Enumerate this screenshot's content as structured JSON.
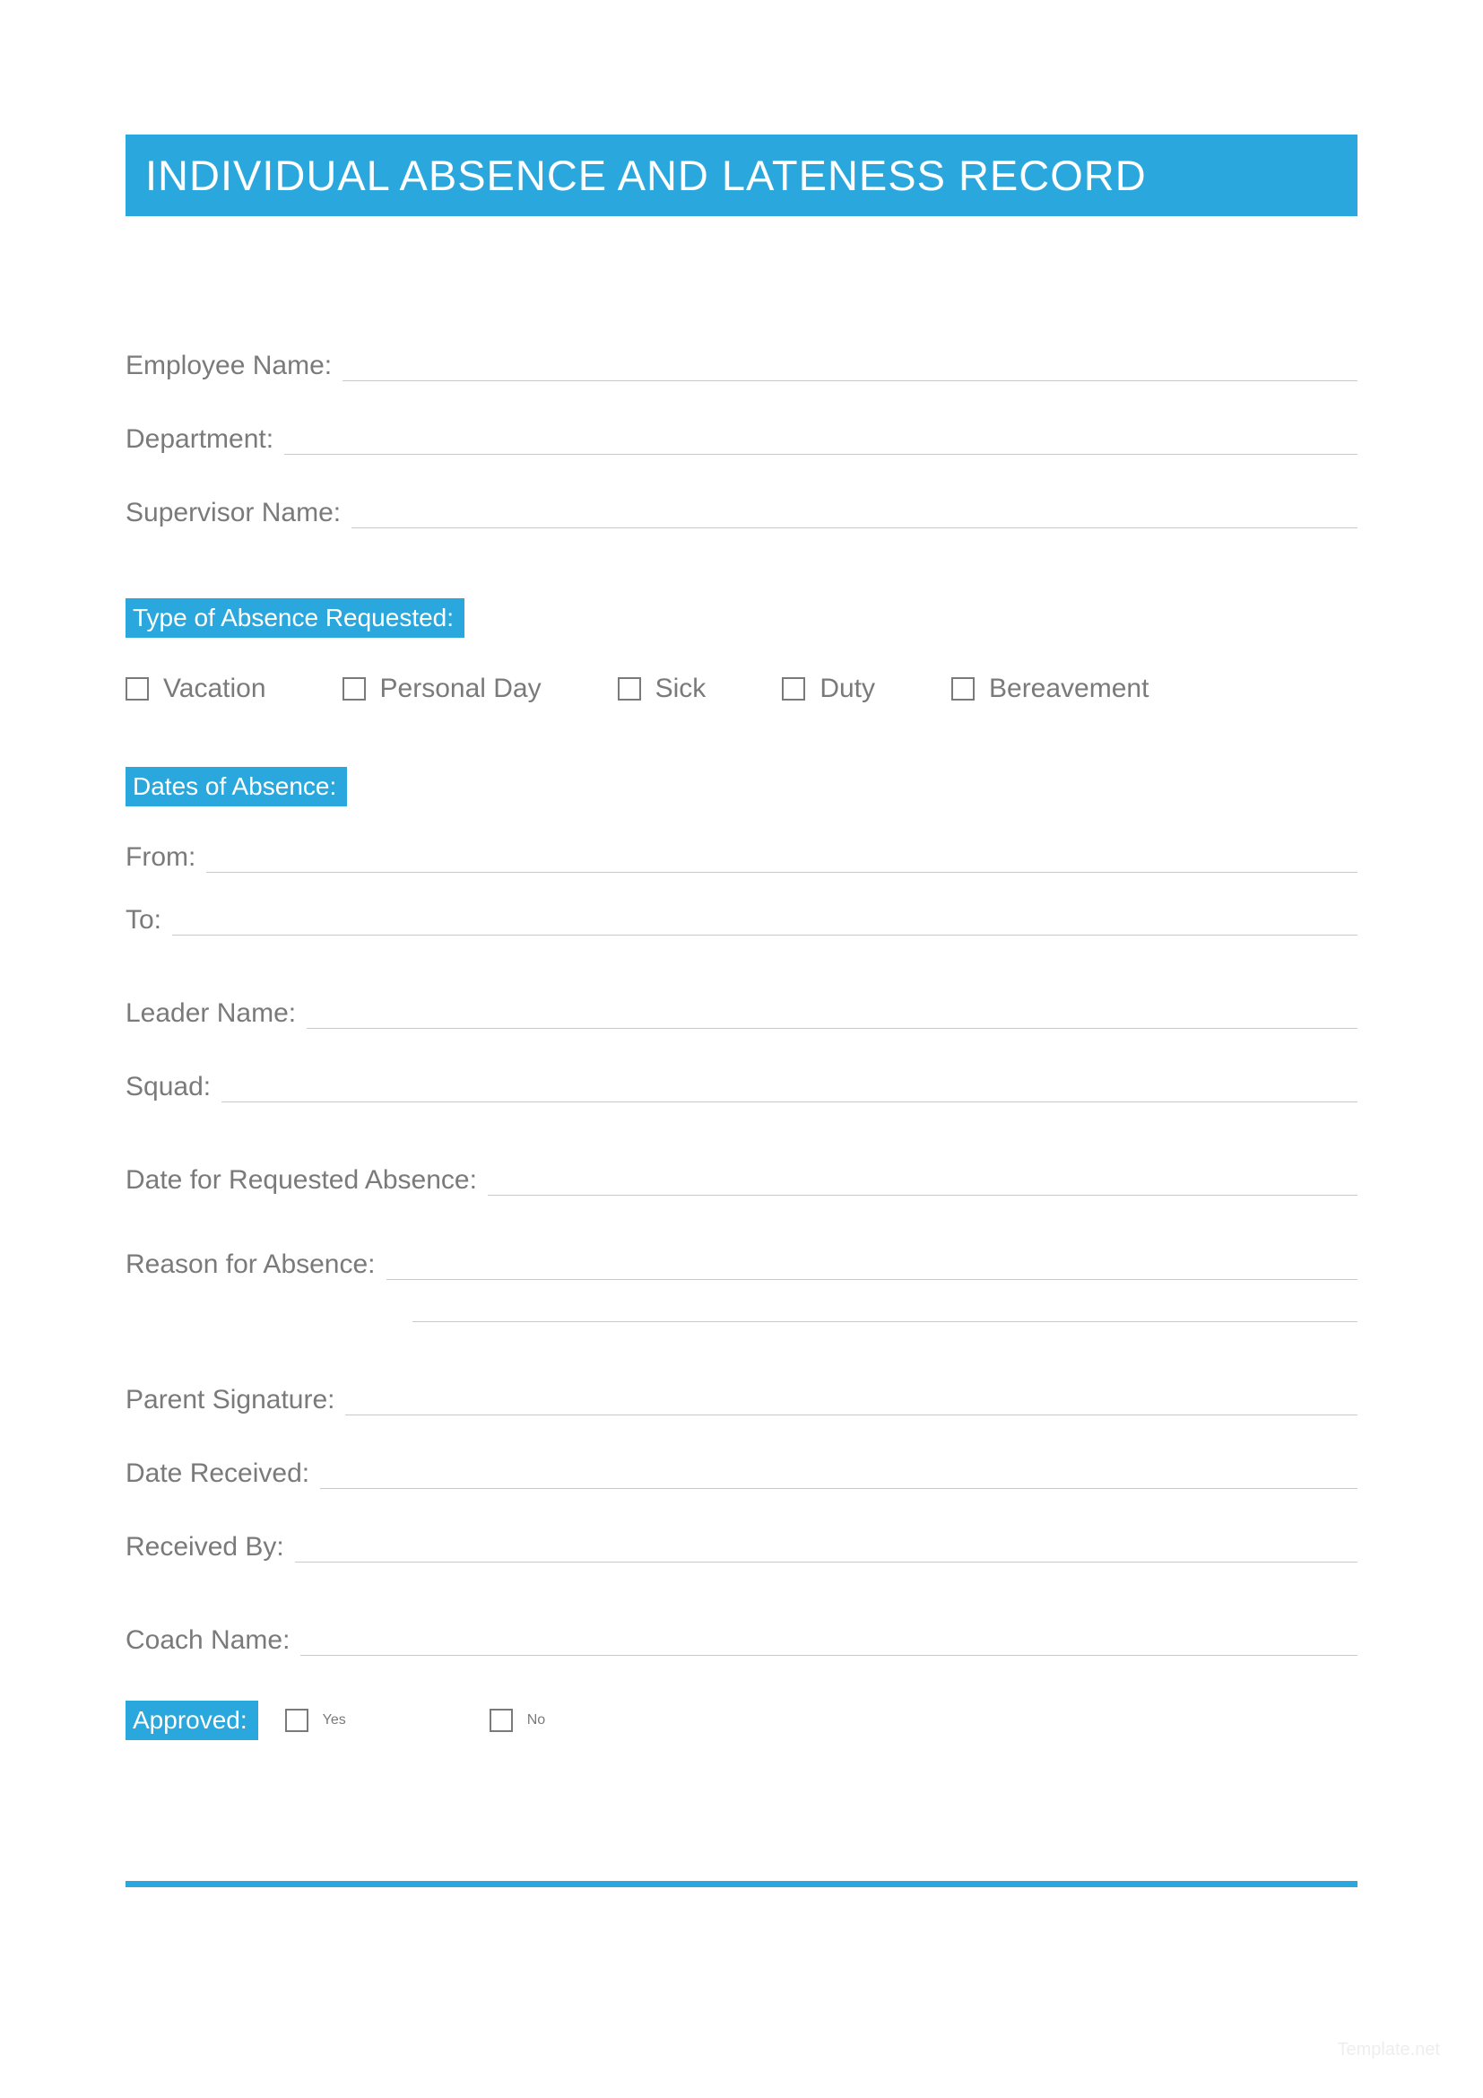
{
  "title": "INDIVIDUAL ABSENCE AND LATENESS RECORD",
  "fields": {
    "employee_name": "Employee Name:",
    "department": "Department:",
    "supervisor_name": "Supervisor Name:",
    "from": "From:",
    "to": "To:",
    "leader_name": "Leader Name:",
    "squad": "Squad:",
    "date_requested": "Date for Requested Absence:",
    "reason": "Reason for Absence:",
    "parent_signature": "Parent Signature:",
    "date_received": "Date Received:",
    "received_by": "Received By:",
    "coach_name": "Coach Name:"
  },
  "sections": {
    "type_of_absence": "Type of Absence Requested:",
    "dates_of_absence": "Dates of Absence:",
    "approved": "Approved:"
  },
  "absence_types": {
    "vacation": "Vacation",
    "personal_day": "Personal Day",
    "sick": "Sick",
    "duty": "Duty",
    "bereavement": "Bereavement"
  },
  "approved_options": {
    "yes": "Yes",
    "no": "No"
  },
  "watermark": "Template.net"
}
